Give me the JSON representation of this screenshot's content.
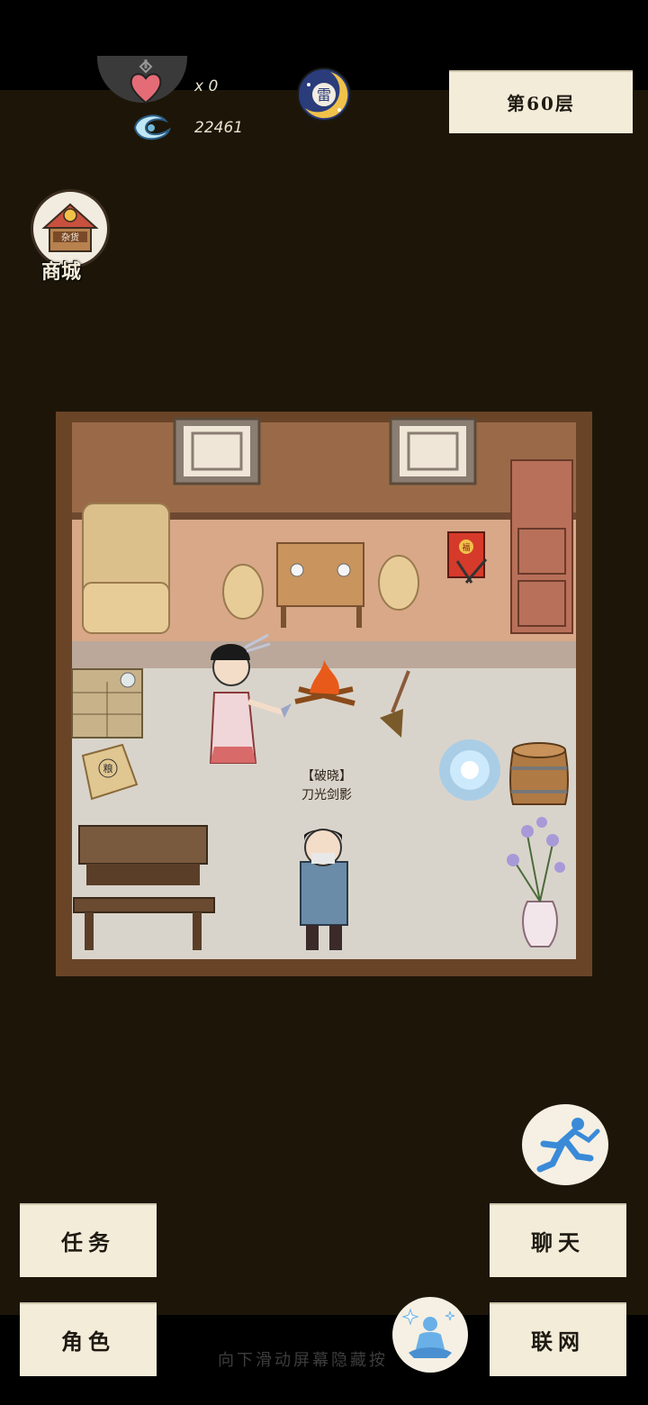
{
  "hud": {
    "lives_count": "x 0",
    "spirit_stones": "22461",
    "floor_label": "第60层",
    "moon_badge_char": "雷"
  },
  "shop": {
    "label": "商城",
    "sign_text": "杂货"
  },
  "room": {
    "npc_title": "【破晓】",
    "npc_name": "刀光剑影",
    "sack_char": "粮",
    "scroll_char": "福"
  },
  "controls": {
    "task": "任务",
    "chat": "聊天",
    "role": "角色",
    "network": "联网",
    "hint": "向下滑动屏幕隐藏按"
  },
  "colors": {
    "background": "#1d1608",
    "paper": "#f3ecd9",
    "wall": "#6a4426",
    "floor": "#d8d2c8"
  }
}
